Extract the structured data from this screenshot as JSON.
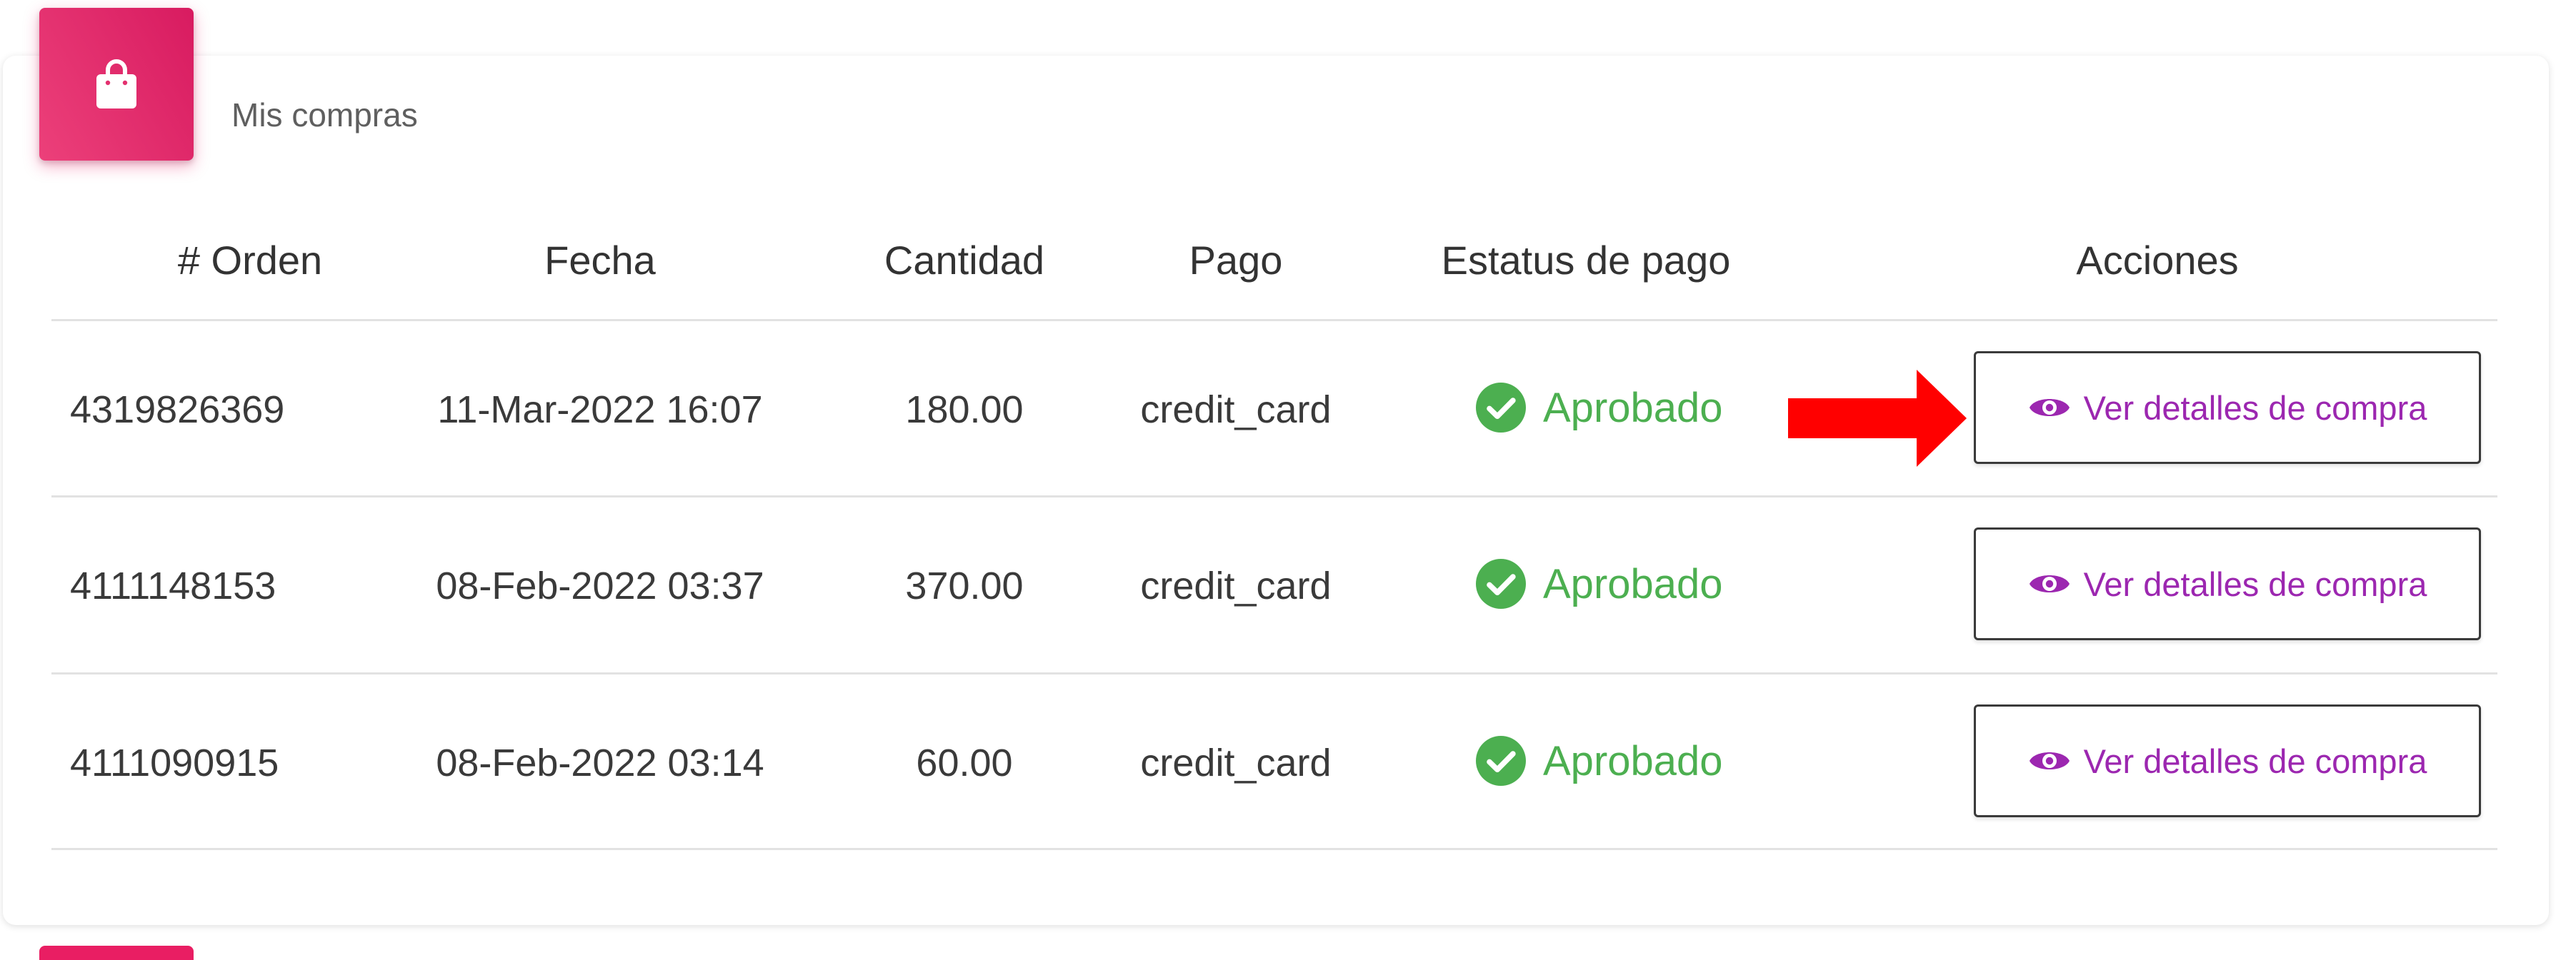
{
  "card": {
    "title": "Mis compras",
    "icon": "shopping-bag-icon",
    "accent_color": "#e91e63"
  },
  "table": {
    "headers": [
      "# Orden",
      "Fecha",
      "Cantidad",
      "Pago",
      "Estatus de pago",
      "Acciones"
    ],
    "rows": [
      {
        "order": "4319826369",
        "date": "11-Mar-2022 16:07",
        "amount": "180.00",
        "payment": "credit_card",
        "status": "Aprobado",
        "action": "Ver detalles de compra"
      },
      {
        "order": "4111148153",
        "date": "08-Feb-2022 03:37",
        "amount": "370.00",
        "payment": "credit_card",
        "status": "Aprobado",
        "action": "Ver detalles de compra"
      },
      {
        "order": "4111090915",
        "date": "08-Feb-2022 03:14",
        "amount": "60.00",
        "payment": "credit_card",
        "status": "Aprobado",
        "action": "Ver detalles de compra"
      }
    ]
  },
  "colors": {
    "status_approved": "#4caf50",
    "action_text": "#9c27b0",
    "annotation_arrow": "#ff0000"
  },
  "icons": {
    "status": "check-circle-icon",
    "action": "eye-icon",
    "annotation": "red-arrow-icon"
  }
}
